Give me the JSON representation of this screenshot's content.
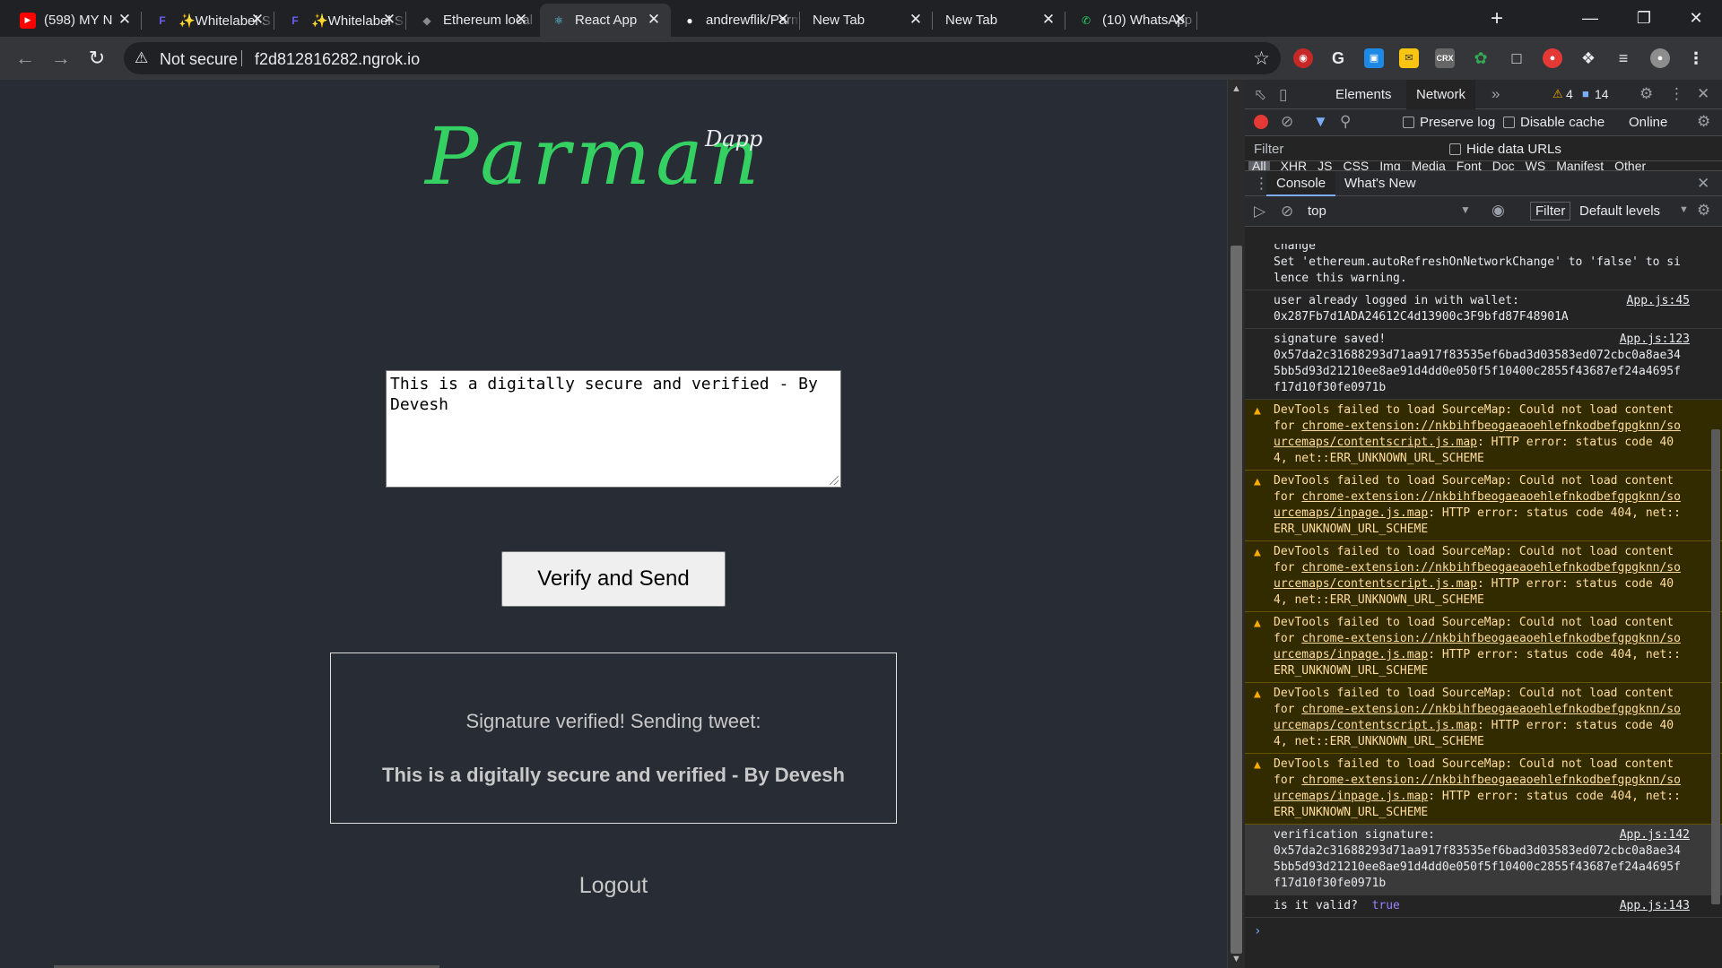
{
  "browser": {
    "tabs": [
      {
        "title": "(598) MY N",
        "favicon": "youtube-icon",
        "color": "#ff0000"
      },
      {
        "title": "✨Whitelabel S",
        "favicon": "whitelabel-icon",
        "color": "#6f5ff6"
      },
      {
        "title": "✨Whitelabel S",
        "favicon": "whitelabel-icon",
        "color": "#6f5ff6"
      },
      {
        "title": "Ethereum local",
        "favicon": "ethereum-icon",
        "color": "#8c8c8c"
      },
      {
        "title": "React App",
        "favicon": "react-icon",
        "color": "#61dafb"
      },
      {
        "title": "andrewflik/Parm",
        "favicon": "github-icon",
        "color": "#ffffff"
      },
      {
        "title": "New Tab",
        "favicon": "",
        "color": ""
      },
      {
        "title": "New Tab",
        "favicon": "",
        "color": ""
      },
      {
        "title": "(10) WhatsApp",
        "favicon": "whatsapp-icon",
        "color": "#25d366"
      }
    ],
    "security_label": "Not secure",
    "url": "f2d812816282.ngrok.io"
  },
  "app": {
    "logo": "Parman",
    "logo_sup": "Dapp",
    "message_text": "This is a digitally secure and verified - By Devesh",
    "verify_button": "Verify and Send",
    "result_status": "Signature verified! Sending tweet:",
    "result_tweet": "This is a digitally secure and verified - By Devesh",
    "logout": "Logout"
  },
  "devtools": {
    "tabs": [
      "Elements",
      "Network"
    ],
    "warn_count": "4",
    "msg_count": "14",
    "preserve_log": "Preserve log",
    "disable_cache": "Disable cache",
    "online": "Online",
    "filter_placeholder": "Filter",
    "hide_data_urls": "Hide data URLs",
    "type_filters": [
      "All",
      "XHR",
      "JS",
      "CSS",
      "Img",
      "Media",
      "Font",
      "Doc",
      "WS",
      "Manifest",
      "Other"
    ],
    "drawer_tabs": [
      "Console",
      "What's New"
    ],
    "context": "top",
    "filter_label": "Filter",
    "levels": "Default levels",
    "messages": [
      {
        "type": "plain",
        "text": "change\nSet 'ethereum.autoRefreshOnNetworkChange' to 'false' to silence this warning.",
        "src": ""
      },
      {
        "type": "plain",
        "text": "user already logged in with wallet:\n0x287Fb7d1ADA24612C4d13900c3F9bfd87F48901A",
        "src": "App.js:45"
      },
      {
        "type": "plain",
        "text": "signature saved!\n0x57da2c31688293d71aa917f83535ef6bad3d03583ed072cbc0a8ae345bb5d93d21210ee8ae91d4dd0e050f5f10400c2855f43687ef24a4695ff17d10f30fe0971b",
        "src": "App.js:123"
      },
      {
        "type": "warn",
        "pre": "DevTools failed to load SourceMap: Could not load content for ",
        "link": "chrome-extension://nkbihfbeogaeaoehlefnkodbefgpgknn/sourcemaps/contentscript.js.map",
        "post": ": HTTP error: status code 404, net::ERR_UNKNOWN_URL_SCHEME"
      },
      {
        "type": "warn",
        "pre": "DevTools failed to load SourceMap: Could not load content for ",
        "link": "chrome-extension://nkbihfbeogaeaoehlefnkodbefgpgknn/sourcemaps/inpage.js.map",
        "post": ": HTTP error: status code 404, net::ERR_UNKNOWN_URL_SCHEME"
      },
      {
        "type": "warn",
        "pre": "DevTools failed to load SourceMap: Could not load content for ",
        "link": "chrome-extension://nkbihfbeogaeaoehlefnkodbefgpgknn/sourcemaps/contentscript.js.map",
        "post": ": HTTP error: status code 404, net::ERR_UNKNOWN_URL_SCHEME"
      },
      {
        "type": "warn",
        "pre": "DevTools failed to load SourceMap: Could not load content for ",
        "link": "chrome-extension://nkbihfbeogaeaoehlefnkodbefgpgknn/sourcemaps/inpage.js.map",
        "post": ": HTTP error: status code 404, net::ERR_UNKNOWN_URL_SCHEME"
      },
      {
        "type": "warn",
        "pre": "DevTools failed to load SourceMap: Could not load content for ",
        "link": "chrome-extension://nkbihfbeogaeaoehlefnkodbefgpgknn/sourcemaps/contentscript.js.map",
        "post": ": HTTP error: status code 404, net::ERR_UNKNOWN_URL_SCHEME"
      },
      {
        "type": "warn",
        "pre": "DevTools failed to load SourceMap: Could not load content for ",
        "link": "chrome-extension://nkbihfbeogaeaoehlefnkodbefgpgknn/sourcemaps/inpage.js.map",
        "post": ": HTTP error: status code 404, net::ERR_UNKNOWN_URL_SCHEME"
      },
      {
        "type": "plain",
        "text": "verification signature:\n0x57da2c31688293d71aa917f83535ef6bad3d03583ed072cbc0a8ae345bb5d93d21210ee8ae91d4dd0e050f5f10400c2855f43687ef24a4695ff17d10f30fe0971b",
        "src": "App.js:142"
      },
      {
        "type": "valid",
        "label": "is it valid?",
        "value": "true",
        "src": "App.js:143"
      }
    ],
    "prompt": "›"
  }
}
